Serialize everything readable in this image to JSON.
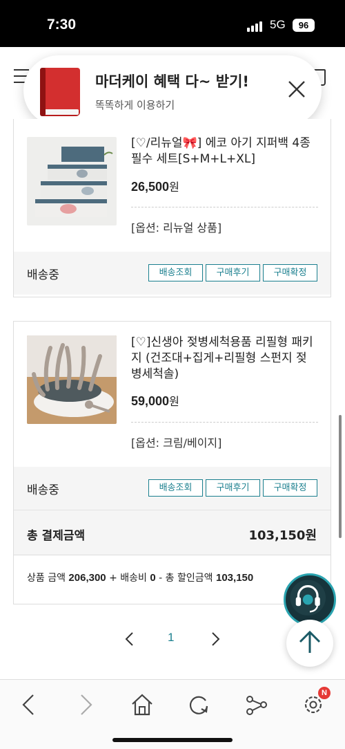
{
  "status_bar": {
    "time": "7:30",
    "network": "5G",
    "battery": "96"
  },
  "toast": {
    "title": "마더케이 혜택 다~ 받기!",
    "subtitle": "똑똑하게 이용하기"
  },
  "orders": [
    {
      "name": "[♡/리뉴얼🎀] 에코 아기 지퍼백 4종 필수 세트[S+M+L+XL]",
      "price": "26,500",
      "price_unit": "원",
      "option": "[옵션: 리뉴얼 상품]",
      "status": "배송중",
      "buttons": [
        "배송조회",
        "구매후기",
        "구매확정"
      ]
    },
    {
      "name": "[♡]신생아 젖병세척용품 리필형 패키지 (건조대+집게+리필형 스펀지 젖병세척솔)",
      "price": "59,000",
      "price_unit": "원",
      "option": "[옵션: 크림/베이지]",
      "status": "배송중",
      "buttons": [
        "배송조회",
        "구매후기",
        "구매확정"
      ]
    }
  ],
  "total": {
    "label": "총 결제금액",
    "amount": "103,150원"
  },
  "summary": {
    "product_label": "상품 금액 ",
    "product_amount": "206,300",
    "shipping_label": " + 배송비 ",
    "shipping_amount": "0",
    "discount_label": " - 총 할인금액 ",
    "discount_amount": "103,150"
  },
  "pagination": {
    "current": "1"
  },
  "toolbar": {
    "settings_badge": "N"
  },
  "colors": {
    "accent": "#1a7f8e",
    "status_row_bg": "#f5f5f5",
    "cs_button": "#17343b"
  }
}
